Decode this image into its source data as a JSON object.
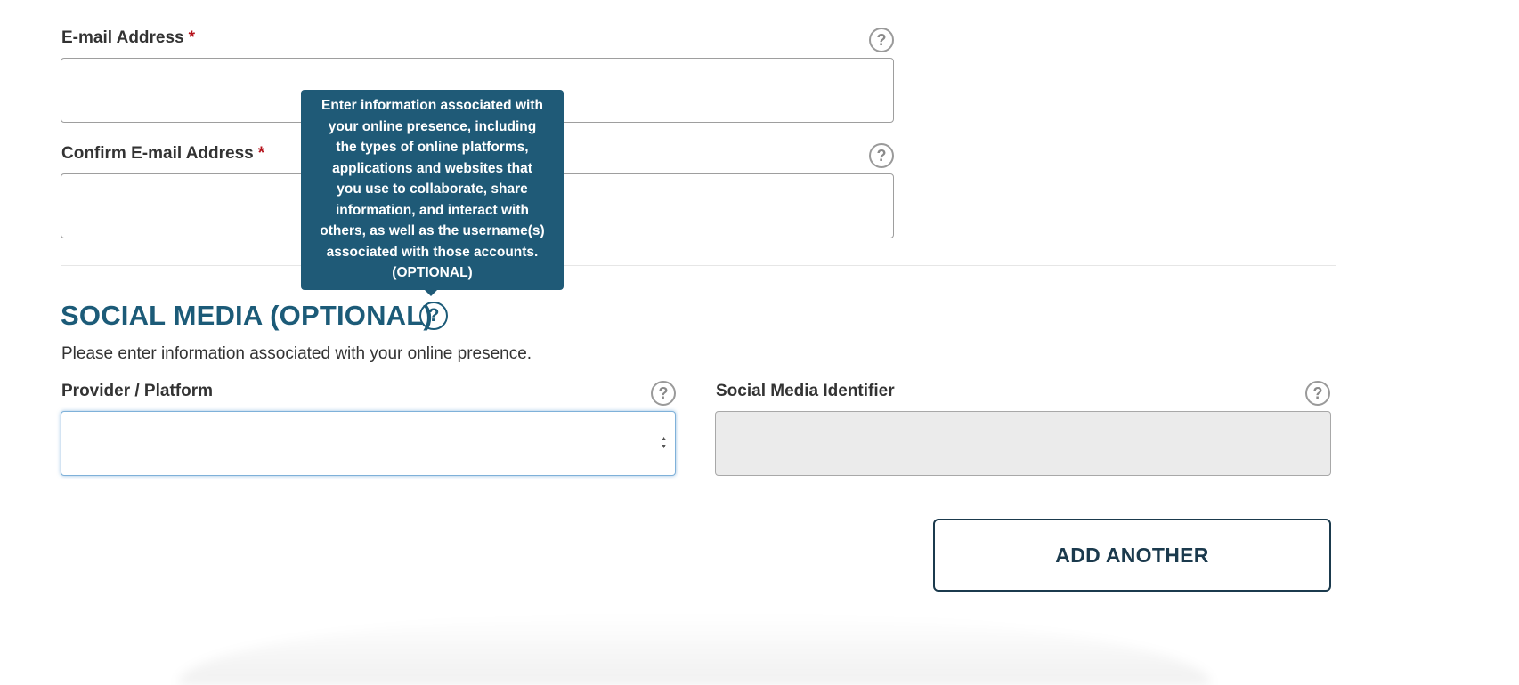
{
  "email": {
    "label": "E-mail Address",
    "required_mark": "*",
    "value": "",
    "help_icon": "question-circle-icon"
  },
  "confirm_email": {
    "label": "Confirm E-mail Address",
    "required_mark": "*",
    "value": "",
    "help_icon": "question-circle-icon"
  },
  "tooltip": {
    "lines": [
      "Enter information associated with",
      "your online presence, including",
      "the types of online platforms,",
      "applications and websites that",
      "you use to collaborate, share",
      "information, and interact with",
      "others, as well as the username(s)",
      "associated with those accounts.",
      "(OPTIONAL)"
    ]
  },
  "social_media": {
    "title": "SOCIAL MEDIA (OPTIONAL)",
    "description": "Please enter information associated with your online presence.",
    "help_icon": "question-circle-icon",
    "provider": {
      "label": "Provider / Platform",
      "selected": ""
    },
    "identifier": {
      "label": "Social Media Identifier",
      "value": ""
    },
    "add_another_label": "ADD ANOTHER"
  },
  "icons": {
    "question_glyph": "?",
    "select_up": "▲",
    "select_down": "▼"
  },
  "colors": {
    "accent": "#1c5b78",
    "tooltip_bg": "#1f5a77",
    "required": "#b5121b",
    "button_border": "#1b3a4d"
  }
}
